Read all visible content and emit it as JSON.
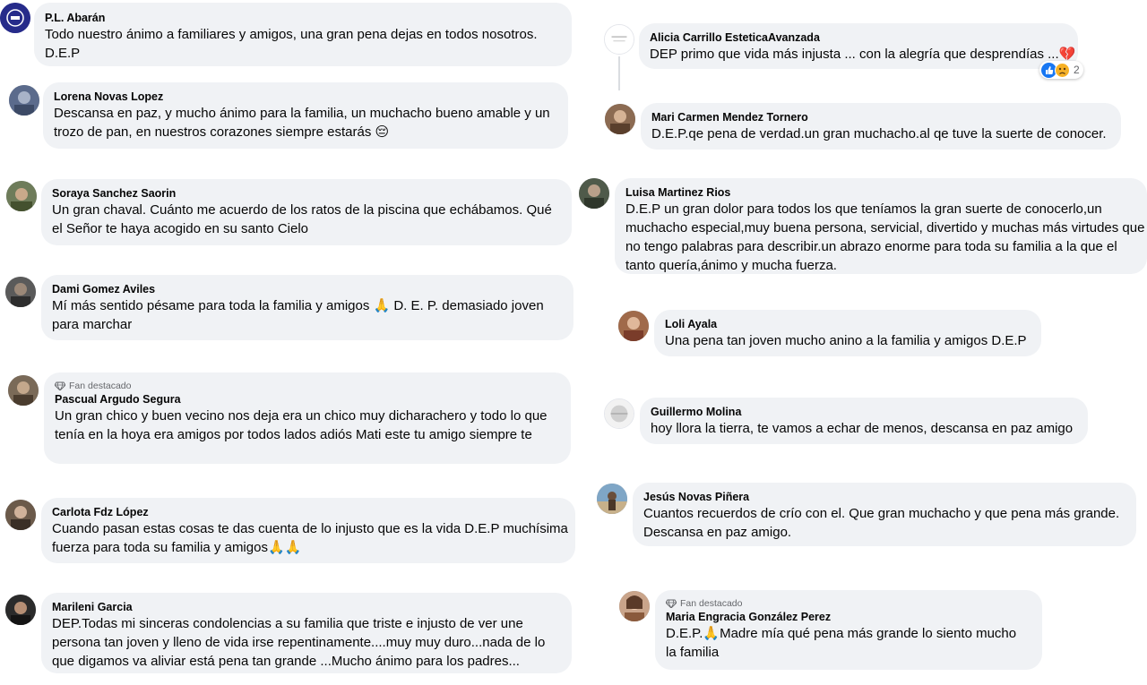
{
  "left_comments": [
    {
      "author": "P.L. Abarán",
      "text": "Todo nuestro ánimo a familiares y amigos, una gran pena dejas en todos nosotros. D.E.P",
      "avatar": "page-logo-avatar"
    },
    {
      "author": "Lorena Novas Lopez",
      "text": "Descansa en paz, y mucho ánimo para la familia, un muchacho bueno amable y un trozo de pan, en nuestros corazones siempre estarás 😔",
      "avatar": "profile-photo-avatar"
    },
    {
      "author": "Soraya Sanchez Saorin",
      "text": "Un gran chaval. Cuánto me acuerdo de los ratos de la piscina que echábamos. Qué el Señor te haya acogido en su santo Cielo",
      "avatar": "profile-photo-avatar"
    },
    {
      "author": "Dami Gomez Aviles",
      "text": "Mí más sentido pésame para toda la familia y amigos 🙏 D. E. P. demasiado joven para marchar",
      "avatar": "profile-photo-avatar"
    },
    {
      "author": "Pascual Argudo Segura",
      "badge": "Fan destacado",
      "text": "Un gran chico y buen vecino nos deja era un chico muy dicharachero y todo lo que tenía en la hoya era amigos por todos lados adiós Mati este tu amigo siempre te llevara en la memoria D.E.P AMIGO",
      "avatar": "profile-photo-avatar"
    },
    {
      "author": "Carlota Fdz López",
      "text": "Cuando pasan estas cosas te das cuenta de lo injusto que es la vida D.E.P muchísima fuerza para toda su familia y amigos🙏🙏",
      "avatar": "profile-photo-avatar"
    },
    {
      "author": "Marileni Garcia",
      "text": "DEP.Todas mi sinceras condolencias a su familia que triste e injusto de ver une persona tan joven y lleno de vida irse repentinamente....muy muy duro...nada de lo que digamos va aliviar está pena tan grande ...Mucho ánimo para los padres...",
      "avatar": "profile-photo-avatar"
    }
  ],
  "right_comments": [
    {
      "author": "Alicia Carrillo EsteticaAvanzada",
      "text": "DEP primo que vida más injusta ... con la alegría que desprendías ...💔",
      "avatar": "profile-photo-avatar",
      "reactions": {
        "types": [
          "like-reaction-icon",
          "sad-reaction-icon"
        ],
        "count": "2"
      }
    },
    {
      "author": "Mari Carmen Mendez Tornero",
      "text": "D.E.P.qe pena de verdad.un gran muchacho.al qe tuve la suerte de conocer.",
      "avatar": "profile-photo-avatar"
    },
    {
      "author": "Luisa Martinez Rios",
      "text": "D.E.P un gran dolor para todos los que teníamos la gran suerte de conocerlo,un muchacho especial,muy buena persona, servicial, divertido y muchas más virtudes que no tengo palabras para describir.un abrazo enorme para toda su familia a la que el tanto quería,ánimo y mucha fuerza.",
      "avatar": "profile-photo-avatar"
    },
    {
      "author": "Loli Ayala",
      "text": "Una pena tan joven mucho anino a la familia y amigos D.E.P",
      "avatar": "profile-photo-avatar"
    },
    {
      "author": "Guillermo Molina",
      "text": "hoy llora la tierra, te vamos a echar de menos, descansa en paz amigo",
      "avatar": "profile-photo-avatar"
    },
    {
      "author": "Jesús Novas Piñera",
      "text": "Cuantos recuerdos de crío con el. Que gran muchacho y que pena más grande. Descansa en paz amigo.",
      "avatar": "profile-photo-avatar"
    },
    {
      "author": "Maria Engracia González Perez",
      "badge": "Fan destacado",
      "text": "D.E.P.🙏Madre mía qué pena más grande lo siento mucho la familia",
      "avatar": "profile-photo-avatar"
    }
  ],
  "colors": {
    "bubble_bg": "#f0f2f5",
    "text": "#050505",
    "meta": "#65676b",
    "like_blue": "#1877f2",
    "sad_yellow": "#f7b125"
  }
}
